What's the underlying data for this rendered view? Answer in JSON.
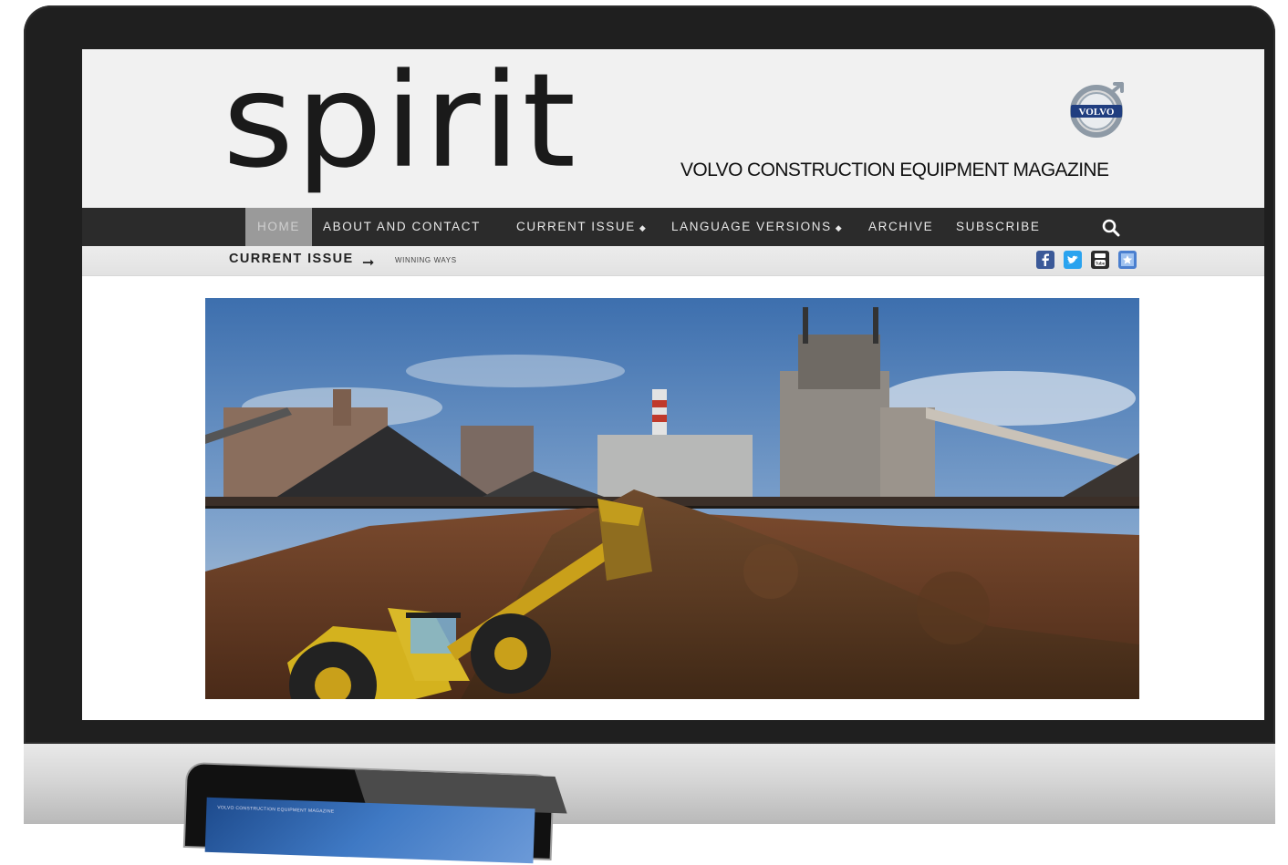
{
  "site": {
    "logo_text": "spirit",
    "tagline": "VOLVO CONSTRUCTION EQUIPMENT MAGAZINE",
    "brand_badge": "VOLVO"
  },
  "nav": {
    "items": [
      {
        "label": "HOME",
        "active": true
      },
      {
        "label": "ABOUT AND CONTACT"
      },
      {
        "label": "CURRENT ISSUE",
        "dropdown": true
      },
      {
        "label": "LANGUAGE VERSIONS",
        "dropdown": true
      },
      {
        "label": "ARCHIVE"
      },
      {
        "label": "SUBSCRIBE"
      }
    ],
    "caret": "◆",
    "search_icon": "search-icon"
  },
  "subbar": {
    "current_label": "CURRENT ISSUE",
    "arrow": "➞",
    "issue_title": "WINNING WAYS",
    "social": [
      {
        "name": "facebook-icon",
        "color": "#3b5998"
      },
      {
        "name": "twitter-icon",
        "color": "#2aa3ef"
      },
      {
        "name": "youtube-icon",
        "color": "#2b2b2b"
      },
      {
        "name": "bookmark-icon",
        "color": "#4a7fcf"
      }
    ]
  },
  "tablet": {
    "header_text": "VOLVO CONSTRUCTION EQUIPMENT MAGAZINE"
  },
  "colors": {
    "nav_bg": "#2b2b2b",
    "header_bg": "#f1f1f1",
    "active_tab": "#9a9a9a",
    "bezel": "#1f1f1f"
  }
}
